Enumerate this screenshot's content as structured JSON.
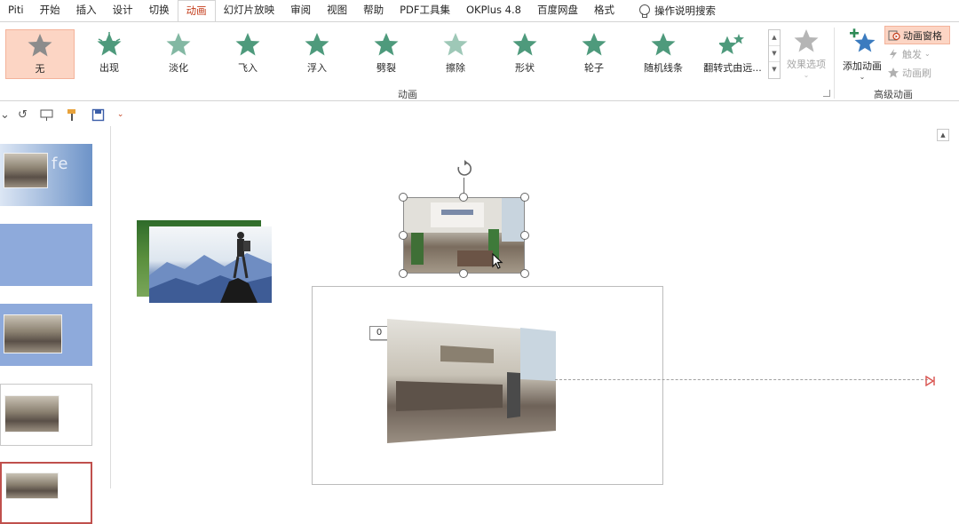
{
  "menu": {
    "tabs": [
      "Piti",
      "开始",
      "插入",
      "设计",
      "切换",
      "动画",
      "幻灯片放映",
      "审阅",
      "视图",
      "帮助",
      "PDF工具集",
      "OKPlus 4.8",
      "百度网盘",
      "格式"
    ],
    "active_tab": "动画",
    "search_label": "操作说明搜索"
  },
  "ribbon": {
    "gallery": [
      {
        "label": "无",
        "icon": "star-none-icon",
        "selected": true
      },
      {
        "label": "出现",
        "icon": "star-appear-icon"
      },
      {
        "label": "淡化",
        "icon": "star-fade-icon"
      },
      {
        "label": "飞入",
        "icon": "star-fly-in-icon"
      },
      {
        "label": "浮入",
        "icon": "star-float-in-icon"
      },
      {
        "label": "劈裂",
        "icon": "star-split-icon"
      },
      {
        "label": "擦除",
        "icon": "star-wipe-icon"
      },
      {
        "label": "形状",
        "icon": "star-shape-icon"
      },
      {
        "label": "轮子",
        "icon": "star-wheel-icon"
      },
      {
        "label": "随机线条",
        "icon": "star-random-bars-icon"
      },
      {
        "label": "翻转式由远...",
        "icon": "star-grow-turn-icon"
      }
    ],
    "effect_options_label": "效果选项",
    "animation_group_label": "动画",
    "add_animation_label": "添加动画",
    "advanced_group_label": "高级动画",
    "advanced_items": [
      {
        "label": "动画窗格",
        "icon": "animation-pane-icon",
        "active": true
      },
      {
        "label": "触发",
        "icon": "trigger-icon",
        "disabled": true
      },
      {
        "label": "动画刷",
        "icon": "animation-painter-icon",
        "disabled": true
      }
    ],
    "colors": {
      "star_green": "#4e9a7c",
      "selected_bg": "#fcd5c4",
      "accent": "#c43e1c"
    }
  },
  "qat": {
    "icons": [
      "undo-dropdown-icon",
      "redo-icon",
      "presentation-icon",
      "format-painter-icon",
      "save-icon",
      "customize-icon"
    ]
  },
  "thumbnails": {
    "slide1_text": "fe"
  },
  "canvas": {
    "animation_badge": "0"
  }
}
